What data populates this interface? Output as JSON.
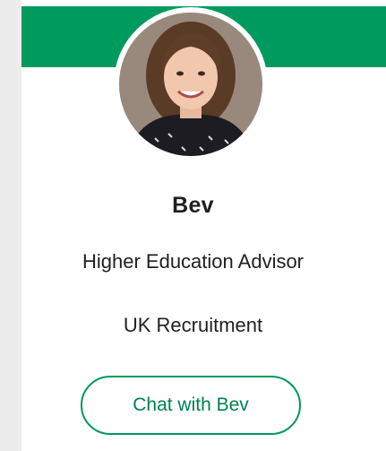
{
  "profile": {
    "name": "Bev",
    "role": "Higher Education Advisor",
    "department": "UK Recruitment",
    "photo_alt": "Bev"
  },
  "actions": {
    "chat_label": "Chat with Bev"
  },
  "colors": {
    "accent": "#009a5e",
    "button_text": "#00804e",
    "background": "#ececec",
    "card": "#ffffff"
  }
}
